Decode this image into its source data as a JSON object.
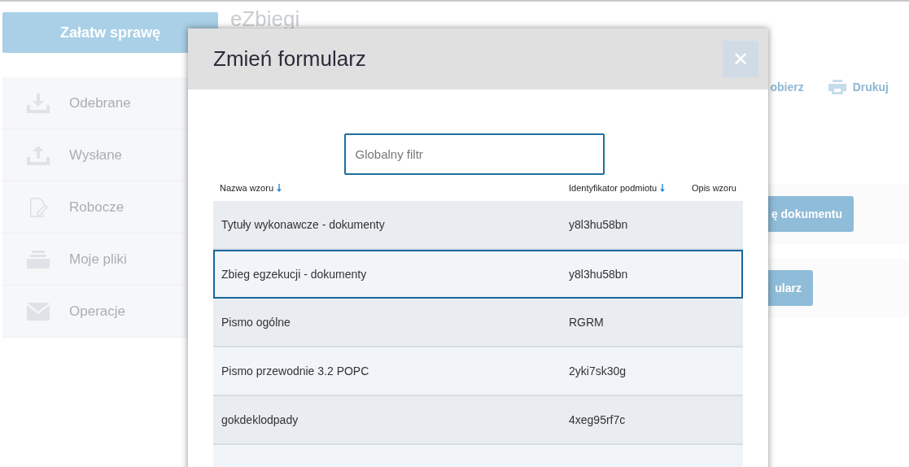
{
  "page": {
    "primary_button": "Załatw sprawę",
    "title": "eZbiegi",
    "sidebar": [
      {
        "label": "Odebrane"
      },
      {
        "label": "Wysłane"
      },
      {
        "label": "Robocze"
      },
      {
        "label": "Moje pliki"
      },
      {
        "label": "Operacje"
      }
    ],
    "toolbar": [
      {
        "label": "obierz"
      },
      {
        "label": "Drukuj"
      }
    ],
    "buttons": [
      "ę dokumentu",
      "ularz"
    ]
  },
  "modal": {
    "title": "Zmień formularz",
    "close": "✕",
    "filter": {
      "placeholder": "Globalny filtr"
    },
    "columns": [
      {
        "label": "Nazwa wzoru",
        "sorted": true
      },
      {
        "label": "Identyfikator podmiotu",
        "sorted": true
      },
      {
        "label": "Opis wzoru",
        "sorted": false
      }
    ],
    "rows": [
      {
        "name": "Tytuły wykonawcze - dokumenty",
        "id": "y8l3hu58bn",
        "selected": false
      },
      {
        "name": "Zbieg egzekucji - dokumenty",
        "id": "y8l3hu58bn",
        "selected": true
      },
      {
        "name": "Pismo ogólne",
        "id": "RGRM",
        "selected": false
      },
      {
        "name": "Pismo przewodnie 3.2 POPC",
        "id": "2yki7sk30g",
        "selected": false
      },
      {
        "name": "gokdeklodpady",
        "id": "4xeg95rf7c",
        "selected": false
      }
    ]
  }
}
